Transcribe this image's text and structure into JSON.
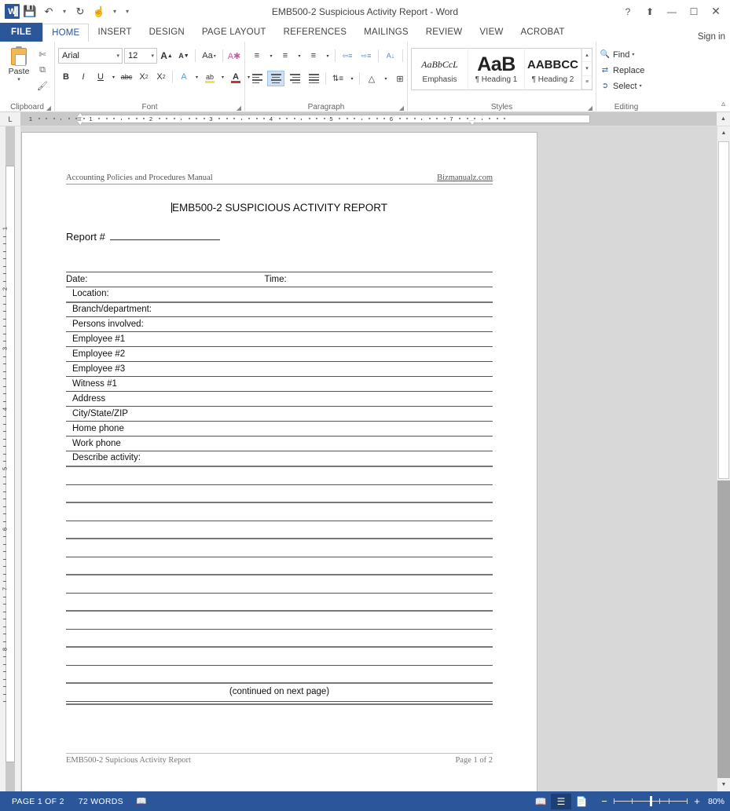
{
  "titlebar": {
    "app_logo": "word-logo",
    "document_title": "EMB500-2 Suspicious Activity Report - Word",
    "quick_access": [
      {
        "name": "save-icon",
        "glyph": "💾"
      },
      {
        "name": "undo-icon",
        "glyph": "↶"
      },
      {
        "name": "redo-icon",
        "glyph": "↻"
      },
      {
        "name": "touch-mode-icon",
        "glyph": "☝"
      },
      {
        "name": "customize-qat-icon",
        "glyph": "▾"
      }
    ],
    "help_label": "?",
    "ribbon_display_label": "⬆",
    "minimize_label": "—",
    "maximize_label": "❐",
    "close_label": "✕"
  },
  "tabs": {
    "file": "FILE",
    "items": [
      "HOME",
      "INSERT",
      "DESIGN",
      "PAGE LAYOUT",
      "REFERENCES",
      "MAILINGS",
      "REVIEW",
      "VIEW",
      "ACROBAT"
    ],
    "active": "HOME",
    "signin": "Sign in"
  },
  "ribbon": {
    "clipboard": {
      "label": "Clipboard",
      "paste_label": "Paste",
      "paste_caret": "▾",
      "cut_icon": "✂",
      "copy_icon": "⧉",
      "format_painter_icon": "✎"
    },
    "font": {
      "label": "Font",
      "font_name": "Arial",
      "font_size": "12",
      "grow_font": "A",
      "shrink_font": "A",
      "change_case": "Aa",
      "clear_formatting": "A",
      "bold": "B",
      "italic": "I",
      "underline": "U",
      "strikethrough": "abc",
      "subscript": "X",
      "superscript": "X",
      "text_effects": "A",
      "highlight": "ab",
      "font_color": "A"
    },
    "paragraph": {
      "label": "Paragraph",
      "bullets": "≡",
      "numbering": "≡",
      "multilevel": "≡",
      "decrease_indent": "←≡",
      "increase_indent": "→≡",
      "sort": "A↓",
      "show_marks": "¶",
      "align_left": "align-left",
      "align_center": "align-center",
      "align_right": "align-right",
      "justify": "justify",
      "line_spacing": "↕",
      "shading": "△",
      "borders": "⊞",
      "active_alignment": "align-center"
    },
    "styles": {
      "label": "Styles",
      "gallery": [
        {
          "preview": "AaBbCcL",
          "name": "Emphasis"
        },
        {
          "preview": "AaB",
          "name": "¶ Heading 1"
        },
        {
          "preview": "AABBCC",
          "name": "¶ Heading 2"
        }
      ],
      "scroll_up": "▴",
      "scroll_down": "▾",
      "more": "≡"
    },
    "editing": {
      "label": "Editing",
      "find": "Find",
      "replace": "Replace",
      "select": "Select",
      "find_caret": "▾",
      "select_caret": "▾"
    },
    "collapse_icon": "⌃"
  },
  "ruler": {
    "tab_selector": "L",
    "horizontal_ticks": [
      "1",
      "1",
      "2",
      "3",
      "4",
      "5",
      "6",
      "7"
    ],
    "vertical_ticks": [
      "1",
      "2",
      "3",
      "4",
      "5",
      "6",
      "7",
      "8"
    ]
  },
  "document": {
    "header": {
      "left": "Accounting Policies and Procedures Manual",
      "right": "Bizmanualz.com"
    },
    "title": "EMB500-2 SUSPICIOUS ACTIVITY REPORT",
    "report_number_label": "Report #",
    "form_rows": [
      {
        "label": "Date:",
        "second": "Time:",
        "thick": false
      },
      {
        "label": "Location:",
        "second": "",
        "thick": true
      },
      {
        "label": "Branch/department:",
        "second": "",
        "thick": false
      },
      {
        "label": "Persons involved:",
        "second": "",
        "thick": false
      },
      {
        "label": "Employee #1",
        "second": "",
        "thick": false
      },
      {
        "label": "Employee #2",
        "second": "",
        "thick": false
      },
      {
        "label": "Employee #3",
        "second": "",
        "thick": false
      },
      {
        "label": "Witness #1",
        "second": "",
        "thick": false
      },
      {
        "label": "Address",
        "second": "",
        "thick": false
      },
      {
        "label": "City/State/ZIP",
        "second": "",
        "thick": false
      },
      {
        "label": "Home phone",
        "second": "",
        "thick": false
      },
      {
        "label": "Work phone",
        "second": "",
        "thick": false
      },
      {
        "label": "Describe activity:",
        "second": "",
        "thick": true
      }
    ],
    "blank_line_count": 12,
    "continued_text": "(continued on next page)",
    "footer": {
      "left": "EMB500-2 Supicious Activity Report",
      "right": "Page 1 of 2"
    }
  },
  "scrollbar": {
    "up_arrow": "▲",
    "down_arrow": "▼"
  },
  "statusbar": {
    "page_info": "PAGE 1 OF 2",
    "word_count": "72 WORDS",
    "proofing_icon": "📖",
    "views": [
      {
        "name": "read-mode-view-button",
        "glyph": "📖",
        "selected": false
      },
      {
        "name": "print-layout-view-button",
        "glyph": "☰",
        "selected": true
      },
      {
        "name": "web-layout-view-button",
        "glyph": "📄",
        "selected": false
      }
    ],
    "zoom_out": "−",
    "zoom_in": "+",
    "zoom_level": "80%"
  },
  "colors": {
    "word_blue": "#2b579a",
    "ribbon_bg": "#ffffff",
    "canvas_gray": "#d8d8d8",
    "accent_select": "#cfe0f4"
  }
}
